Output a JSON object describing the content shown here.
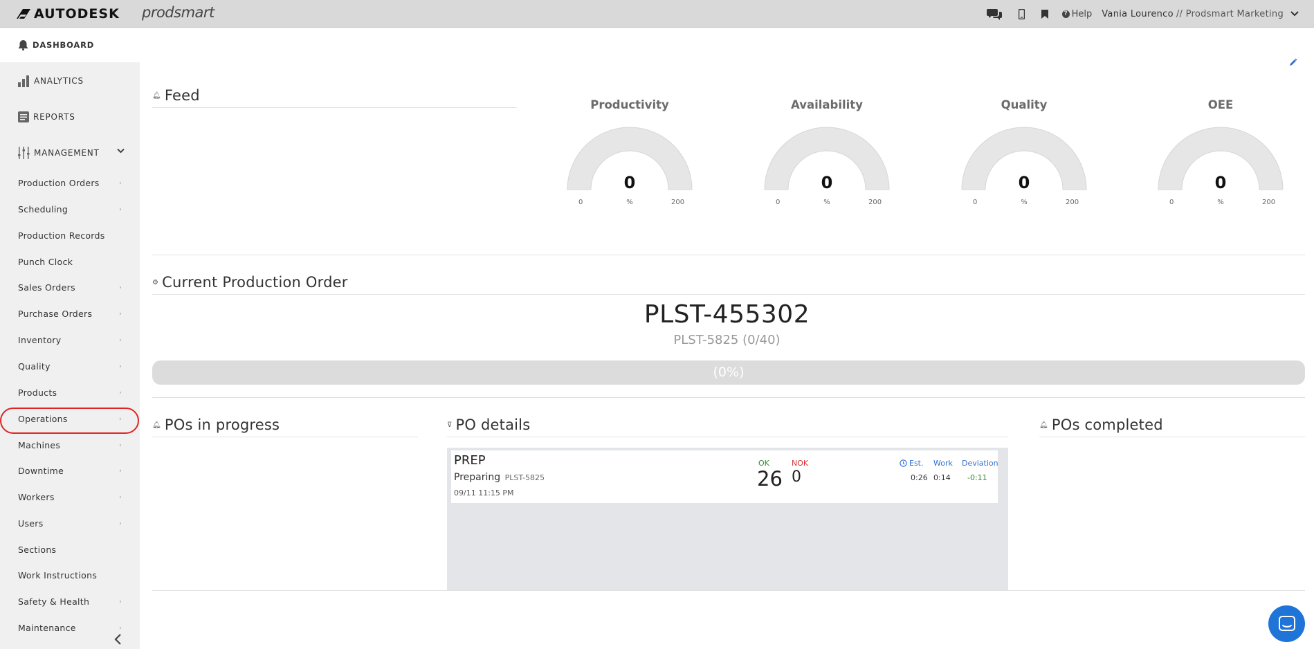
{
  "topbar": {
    "brand": "AUTODESK",
    "product": "prodsmart",
    "help_label": "Help",
    "user_name": "Vania Lourenco",
    "user_org": "// Prodsmart Marketing",
    "icons": [
      "chat-icon",
      "mobile-icon",
      "bookmark-icon",
      "help-icon",
      "chevron-down-icon"
    ]
  },
  "sidebar": {
    "dashboard": "DASHBOARD",
    "analytics": "ANALYTICS",
    "reports": "REPORTS",
    "management": "MANAGEMENT",
    "items": [
      {
        "label": "Production Orders",
        "chevron": true
      },
      {
        "label": "Scheduling",
        "chevron": true
      },
      {
        "label": "Production Records",
        "chevron": false
      },
      {
        "label": "Punch Clock",
        "chevron": false
      },
      {
        "label": "Sales Orders",
        "chevron": true
      },
      {
        "label": "Purchase Orders",
        "chevron": true
      },
      {
        "label": "Inventory",
        "chevron": true
      },
      {
        "label": "Quality",
        "chevron": true
      },
      {
        "label": "Products",
        "chevron": true
      },
      {
        "label": "Operations",
        "chevron": true
      },
      {
        "label": "Machines",
        "chevron": true
      },
      {
        "label": "Downtime",
        "chevron": true
      },
      {
        "label": "Workers",
        "chevron": true
      },
      {
        "label": "Users",
        "chevron": true
      },
      {
        "label": "Sections",
        "chevron": false
      },
      {
        "label": "Work Instructions",
        "chevron": false
      },
      {
        "label": "Safety & Health",
        "chevron": true
      },
      {
        "label": "Maintenance",
        "chevron": true
      }
    ],
    "highlighted_item": "Products"
  },
  "main": {
    "feed_title": "Feed",
    "gauges": [
      {
        "title": "Productivity",
        "value": "0",
        "unit": "%",
        "min": "0",
        "max": "200"
      },
      {
        "title": "Availability",
        "value": "0",
        "unit": "%",
        "min": "0",
        "max": "200"
      },
      {
        "title": "Quality",
        "value": "0",
        "unit": "%",
        "min": "0",
        "max": "200"
      },
      {
        "title": "OEE",
        "value": "0",
        "unit": "%",
        "min": "0",
        "max": "200"
      }
    ],
    "current_po_title": "Current Production Order",
    "current_po": "PLST-455302",
    "current_po_sub": "PLST-5825 (0/40)",
    "progress_label": "(0%)",
    "progress_fraction": 0,
    "pos_in_progress_title": "POs in progress",
    "po_details_title": "PO details",
    "pos_completed_title": "POs completed",
    "po_card": {
      "title": "PREP",
      "status": "Preparing",
      "code": "PLST-5825",
      "datetime": "09/11 11:15 PM",
      "ok_label": "OK",
      "nok_label": "NOK",
      "ok_value": "26",
      "nok_value": "0",
      "est_label": "Est.",
      "work_label": "Work",
      "deviation_label": "Deviation",
      "est_value": "0:26",
      "work_value": "0:14",
      "deviation_value": "-0:11"
    }
  },
  "colors": {
    "topbar_bg": "#d9d9d9",
    "sidebar_bg": "#f0f0f0",
    "accent_blue": "#1f74d8",
    "highlight_red": "#e02424",
    "ok_green": "#2e8b2e",
    "nok_red": "#d63030"
  }
}
